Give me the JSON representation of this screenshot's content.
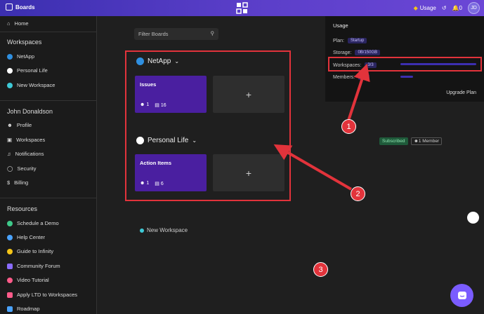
{
  "topbar": {
    "brand": "Boards",
    "usage_label": "Usage",
    "notif_count": "0",
    "avatar": "JD"
  },
  "sidebar": {
    "home": "Home",
    "workspaces_head": "Workspaces",
    "workspaces": [
      {
        "label": "NetApp",
        "icon": "netapp-icon"
      },
      {
        "label": "Personal Life",
        "icon": "heart-icon"
      },
      {
        "label": "New Workspace",
        "icon": "plus-circle-icon"
      }
    ],
    "user_head": "John Donaldson",
    "user_items": [
      {
        "label": "Profile",
        "icon": "user-icon"
      },
      {
        "label": "Workspaces",
        "icon": "workspaces-icon"
      },
      {
        "label": "Notifications",
        "icon": "bell-icon"
      },
      {
        "label": "Security",
        "icon": "lock-icon"
      },
      {
        "label": "Billing",
        "icon": "dollar-icon"
      }
    ],
    "resources_head": "Resources",
    "resources": [
      {
        "label": "Schedule a Demo",
        "icon": "calendar-icon",
        "color": "#3ec98a"
      },
      {
        "label": "Help Center",
        "icon": "help-icon",
        "color": "#4aa3ff"
      },
      {
        "label": "Guide to Infinity",
        "icon": "bulb-icon",
        "color": "#f5c518"
      },
      {
        "label": "Community Forum",
        "icon": "chat-icon",
        "color": "#8a6cff"
      },
      {
        "label": "Video Tutorial",
        "icon": "video-icon",
        "color": "#ff5b8a"
      },
      {
        "label": "Apply LTD to Workspaces",
        "icon": "tag-icon",
        "color": "#ff5b8a"
      },
      {
        "label": "Roadmap",
        "icon": "map-icon",
        "color": "#4aa3ff"
      }
    ]
  },
  "main": {
    "filter_placeholder": "Filter Boards",
    "workspaces": [
      {
        "name": "NetApp",
        "board": {
          "title": "Issues",
          "members": "1",
          "items": "16"
        }
      },
      {
        "name": "Personal Life",
        "board": {
          "title": "Action Items",
          "members": "1",
          "items": "6"
        }
      }
    ],
    "add_symbol": "+",
    "new_workspace": "New Workspace",
    "subscribed": "Subscribed",
    "member_count": "1 Member"
  },
  "usage_panel": {
    "title": "Usage",
    "plan_label": "Plan:",
    "plan_value": "Startup",
    "storage_label": "Storage:",
    "storage_value": "0B/150GB",
    "workspaces_label": "Workspaces:",
    "workspaces_value": "3/3",
    "workspaces_fill": 1.0,
    "members_label": "Members:",
    "members_value": "1/5",
    "members_fill": 0.2,
    "upgrade": "Upgrade Plan"
  },
  "annotations": [
    "1",
    "2",
    "3"
  ],
  "colors": {
    "accent": "#5a3ec8",
    "card": "#4a1fa0",
    "callout": "#e2333b"
  }
}
